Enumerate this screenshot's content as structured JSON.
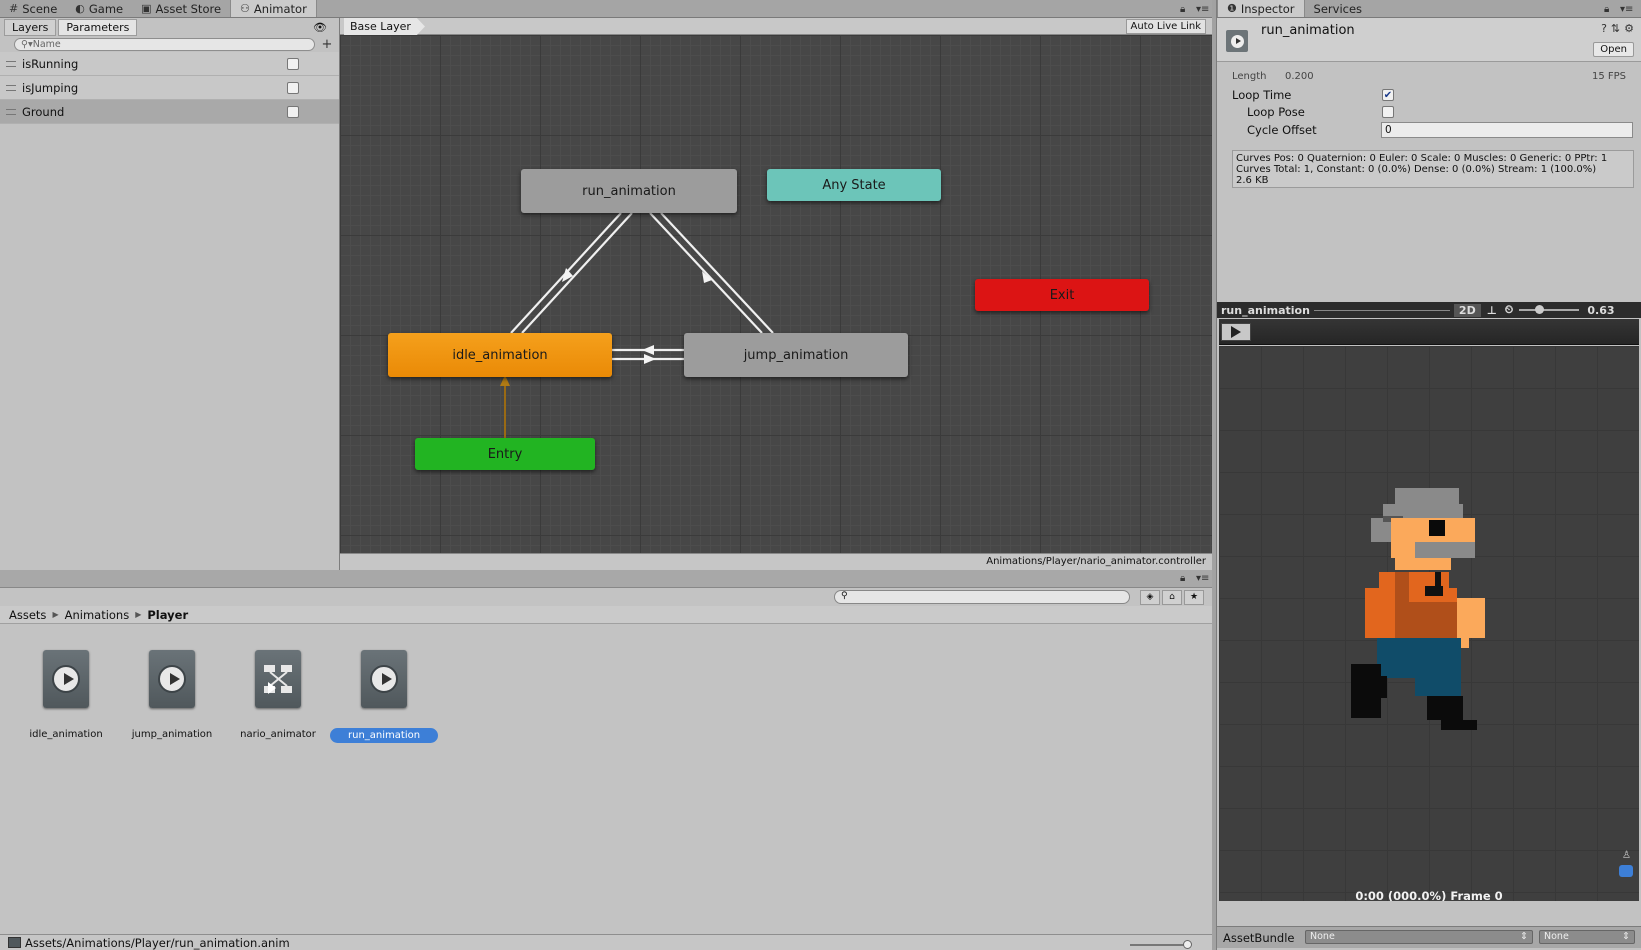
{
  "top_tabs": [
    {
      "label": "Scene",
      "icon": "#"
    },
    {
      "label": "Game",
      "icon": "◐"
    },
    {
      "label": "Asset Store",
      "icon": "▣"
    },
    {
      "label": "Animator",
      "icon": "⚇"
    }
  ],
  "animator": {
    "subtabs": [
      "Layers",
      "Parameters"
    ],
    "search_placeholder": "Name",
    "parameters": [
      {
        "name": "isRunning",
        "checked": false
      },
      {
        "name": "isJumping",
        "checked": false
      },
      {
        "name": "Ground",
        "checked": false
      }
    ],
    "layer": "Base Layer",
    "auto_live_link": "Auto Live Link",
    "states": {
      "run": "run_animation",
      "any": "Any State",
      "exit": "Exit",
      "idle": "idle_animation",
      "jump": "jump_animation",
      "entry": "Entry"
    },
    "controller_path": "Animations/Player/nario_animator.controller"
  },
  "project": {
    "breadcrumb": [
      "Assets",
      "Animations",
      "Player"
    ],
    "assets": [
      {
        "name": "idle_animation",
        "type": "animation-clip"
      },
      {
        "name": "jump_animation",
        "type": "animation-clip"
      },
      {
        "name": "nario_animator",
        "type": "animator-controller"
      },
      {
        "name": "run_animation",
        "type": "animation-clip",
        "selected": true
      }
    ],
    "status_path": "Assets/Animations/Player/run_animation.anim"
  },
  "inspector": {
    "tabs": [
      "Inspector",
      "Services"
    ],
    "title": "run_animation",
    "open_label": "Open",
    "length_label": "Length",
    "length_value": "0.200",
    "fps": "15 FPS",
    "loop_time_label": "Loop Time",
    "loop_time": true,
    "loop_pose_label": "Loop Pose",
    "loop_pose": false,
    "cycle_offset_label": "Cycle Offset",
    "cycle_offset": "0",
    "curves_line1": "Curves Pos: 0 Quaternion: 0 Euler: 0 Scale: 0 Muscles: 0 Generic: 0 PPtr: 1",
    "curves_line2": "Curves Total: 1, Constant: 0 (0.0%) Dense: 0 (0.0%) Stream: 1 (100.0%)",
    "curves_line3": "2.6 KB",
    "preview_title": "run_animation",
    "preview_mode": "2D",
    "preview_speed": "0.63",
    "frame_label": "0:00 (000.0%) Frame 0",
    "asset_bundle_label": "AssetBundle",
    "bundle_value": "None",
    "variant_value": "None"
  },
  "colors": {
    "idle_state": "#f08c0c",
    "entry_state": "#22b422",
    "any_state": "#6cc5b9",
    "exit_state": "#dc1414",
    "default_state": "#9c9c9c",
    "selection": "#3d7fd7"
  }
}
